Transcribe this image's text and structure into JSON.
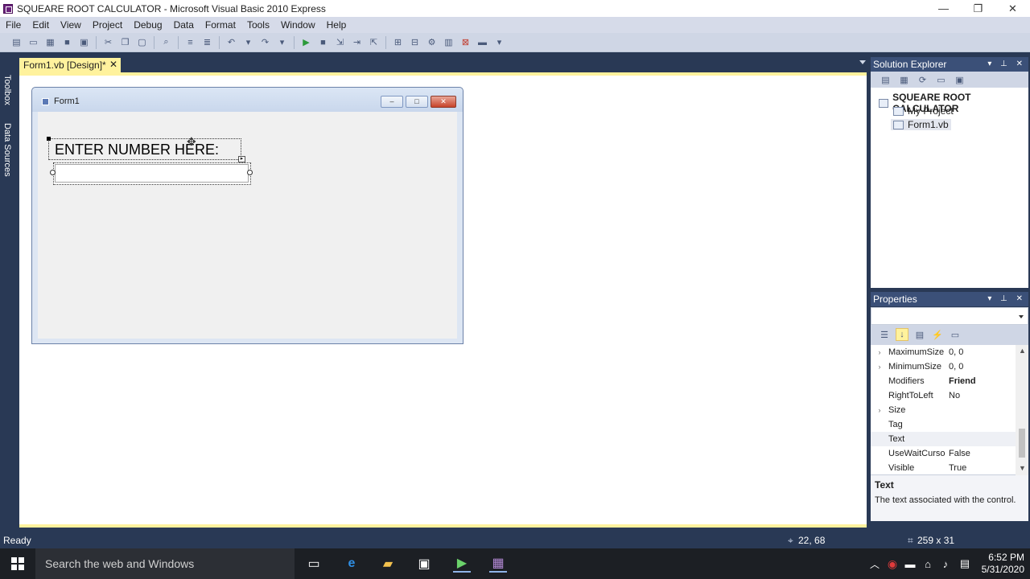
{
  "window": {
    "title": "SQUEARE ROOT CALCULATOR - Microsoft Visual Basic 2010 Express",
    "min_glyph": "—",
    "restore_glyph": "❐",
    "close_glyph": "✕"
  },
  "menu": [
    "File",
    "Edit",
    "View",
    "Project",
    "Debug",
    "Data",
    "Format",
    "Tools",
    "Window",
    "Help"
  ],
  "side_tabs": [
    "Toolbox",
    "Data Sources"
  ],
  "doc_tab": {
    "label": "Form1.vb [Design]*",
    "close": "✕"
  },
  "form": {
    "title": "Form1",
    "min_glyph": "–",
    "max_glyph": "□",
    "close_glyph": "✕",
    "label_text": "ENTER NUMBER HERE:",
    "textbox_value": ""
  },
  "solution_explorer": {
    "title": "Solution Explorer",
    "header_buttons": "▾ ⊥ ✕",
    "tree": [
      "SQUEARE ROOT CALCULATOR",
      "My Project",
      "Form1.vb"
    ]
  },
  "properties": {
    "title": "Properties",
    "header_buttons": "▾ ⊥ ✕",
    "object_selector": "",
    "rows": [
      {
        "expand": "›",
        "name": "MaximumSize",
        "value": "0, 0",
        "bold": false
      },
      {
        "expand": "›",
        "name": "MinimumSize",
        "value": "0, 0",
        "bold": false
      },
      {
        "expand": "",
        "name": "Modifiers",
        "value": "Friend",
        "bold": true
      },
      {
        "expand": "",
        "name": "RightToLeft",
        "value": "No",
        "bold": false
      },
      {
        "expand": "›",
        "name": "Size",
        "value": "",
        "bold": false
      },
      {
        "expand": "",
        "name": "Tag",
        "value": "",
        "bold": false
      },
      {
        "expand": "",
        "name": "Text",
        "value": "",
        "bold": false
      },
      {
        "expand": "",
        "name": "UseWaitCursor",
        "value": "False",
        "bold": false
      },
      {
        "expand": "",
        "name": "Visible",
        "value": "True",
        "bold": false
      }
    ],
    "description_title": "Text",
    "description_text": "The text associated with the control."
  },
  "status": {
    "left": "Ready",
    "position": "22, 68",
    "size": "259 x 31"
  },
  "taskbar": {
    "search_placeholder": "Search the web and Windows",
    "time": "6:52 PM",
    "date": "5/31/2020"
  },
  "colors": {
    "ide_dark": "#293955",
    "highlight_yellow": "#fff29d",
    "menu_bg": "#d6dbe9"
  }
}
